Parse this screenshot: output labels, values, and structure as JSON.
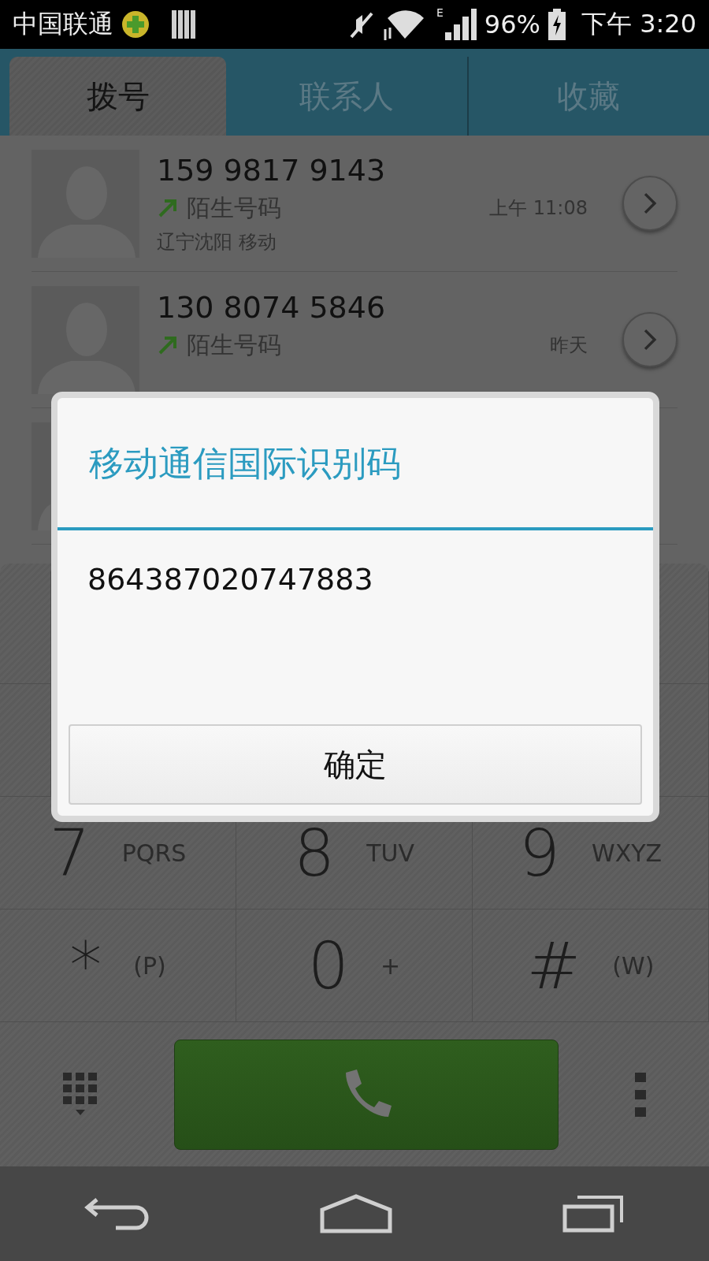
{
  "status_bar": {
    "carrier": "中国联通",
    "network_type": "E",
    "battery": "96%",
    "time": "下午 3:20"
  },
  "tabs": [
    {
      "label": "拨号",
      "selected": true
    },
    {
      "label": "联系人",
      "selected": false
    },
    {
      "label": "收藏",
      "selected": false
    }
  ],
  "call_log": [
    {
      "number": "159 9817 9143",
      "label": "陌生号码",
      "time": "上午 11:08",
      "location": "辽宁沈阳 移动"
    },
    {
      "number": "130 8074 5846",
      "label": "陌生号码",
      "time": "昨天"
    }
  ],
  "keypad": [
    {
      "digit": "7",
      "letters": "PQRS"
    },
    {
      "digit": "8",
      "letters": "TUV"
    },
    {
      "digit": "9",
      "letters": "WXYZ"
    },
    {
      "digit": "*",
      "letters": "(P)"
    },
    {
      "digit": "0",
      "letters": "+"
    },
    {
      "digit": "#",
      "letters": "(W)"
    }
  ],
  "dialog": {
    "title": "移动通信国际识别码",
    "message": "864387020747883",
    "buttons": [
      "确定"
    ]
  }
}
